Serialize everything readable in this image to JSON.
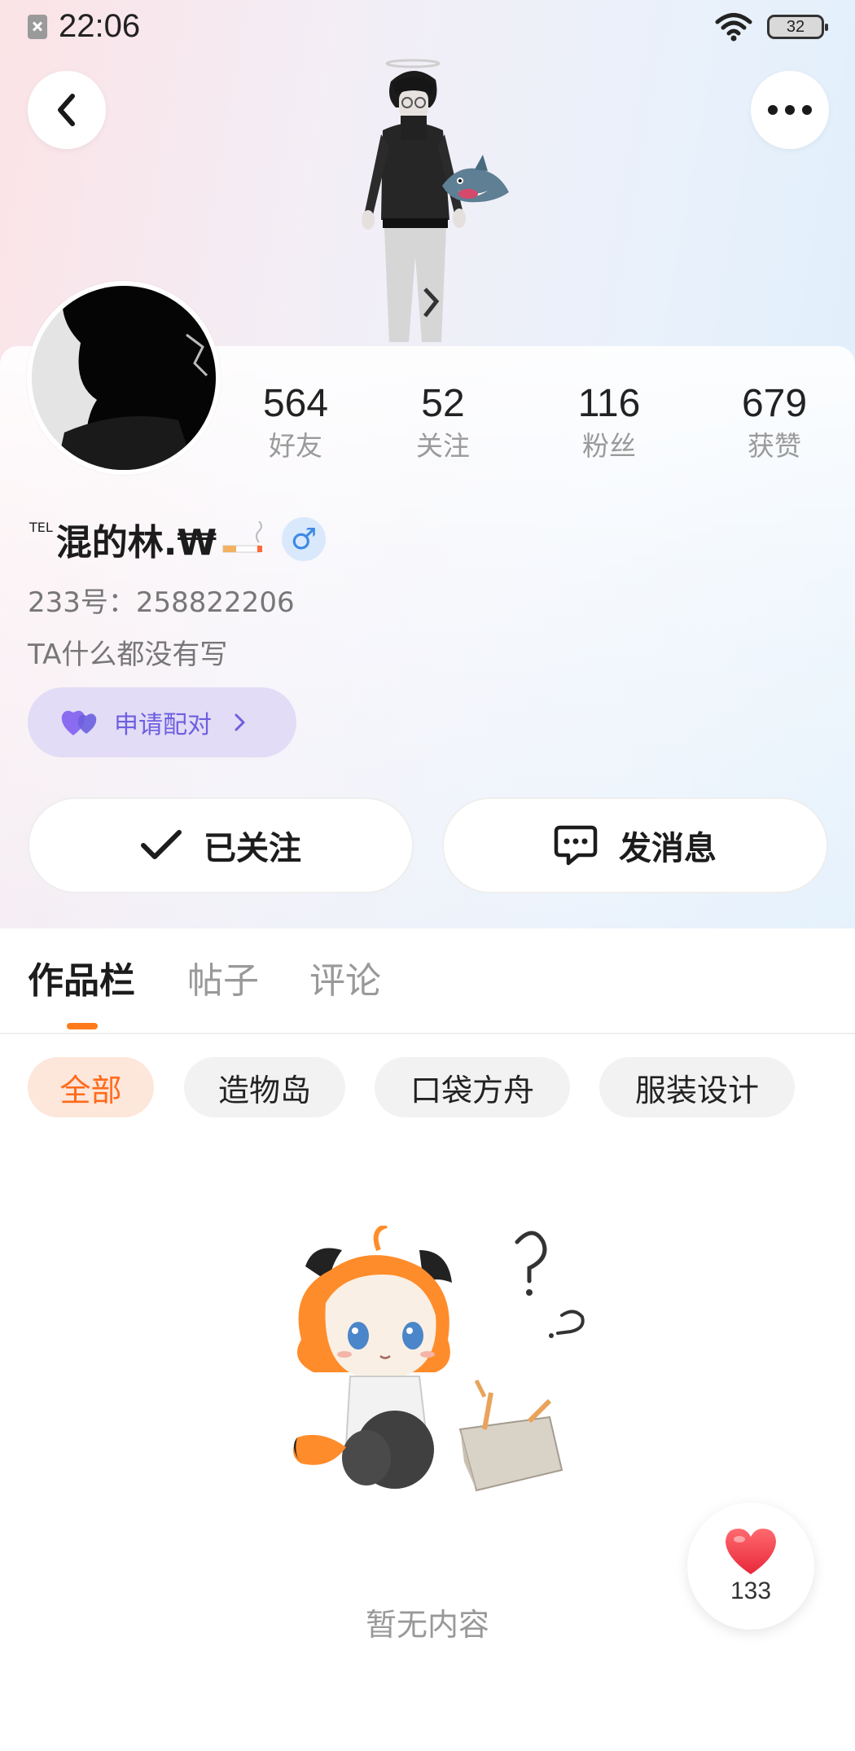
{
  "status_bar": {
    "time": "22:06",
    "battery": "32"
  },
  "profile": {
    "name_prefix": "TEL",
    "name": "混的林.₩",
    "gender_symbol": "♂",
    "id_line": "233号：258822206",
    "bio": "TA什么都没有写"
  },
  "stats": [
    {
      "value": "564",
      "label": "好友"
    },
    {
      "value": "52",
      "label": "关注"
    },
    {
      "value": "116",
      "label": "粉丝"
    },
    {
      "value": "679",
      "label": "获赞"
    }
  ],
  "pair_button": {
    "label": "申请配对"
  },
  "actions": {
    "follow_label": "已关注",
    "message_label": "发消息"
  },
  "tabs": [
    {
      "label": "作品栏",
      "active": true
    },
    {
      "label": "帖子",
      "active": false
    },
    {
      "label": "评论",
      "active": false
    }
  ],
  "filters": [
    {
      "label": "全部",
      "active": true
    },
    {
      "label": "造物岛",
      "active": false
    },
    {
      "label": "口袋方舟",
      "active": false
    },
    {
      "label": "服装设计",
      "active": false
    }
  ],
  "empty_state": {
    "text": "暂无内容"
  },
  "like": {
    "count": "133"
  },
  "colors": {
    "accent": "#ff7a1a",
    "pair_purple": "#6d5fe0",
    "gender_blue": "#3d89e6",
    "like_red": "#f03a48"
  },
  "icons": {
    "back": "chevron-left-icon",
    "more": "more-dots-icon",
    "follow": "checkmark-icon",
    "message": "chat-bubble-icon",
    "pair": "double-heart-icon",
    "like": "heart-icon"
  }
}
